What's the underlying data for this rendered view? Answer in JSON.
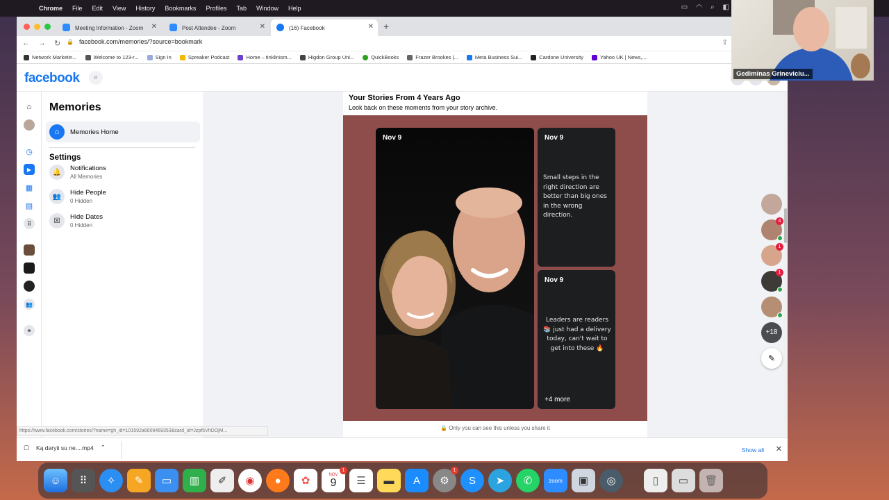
{
  "menubar": {
    "app": "Chrome",
    "items": [
      "File",
      "Edit",
      "View",
      "History",
      "Bookmarks",
      "Profiles",
      "Tab",
      "Window",
      "Help"
    ]
  },
  "tabs": [
    {
      "title": "Meeting Information - Zoom"
    },
    {
      "title": "Post Attendee - Zoom"
    },
    {
      "title": "(16) Facebook"
    }
  ],
  "address": {
    "url": "facebook.com/memories/?source=bookmark"
  },
  "bookmarks": [
    "Network Marketin...",
    "Welcome to 123-r...",
    "Sign In",
    "Spreaker Podcast",
    "Home – tinklinism...",
    "Higdon Group Uni...",
    "QuickBooks",
    "Frazer Brookes |...",
    "Meta Business Sui...",
    "Cardone University",
    "Yahoo UK | News,..."
  ],
  "fb": {
    "logo": "facebook"
  },
  "sidebar": {
    "title": "Memories",
    "home_label": "Memories Home",
    "settings_heading": "Settings",
    "items": [
      {
        "label": "Notifications",
        "sub": "All Memories"
      },
      {
        "label": "Hide People",
        "sub": "0 Hidden"
      },
      {
        "label": "Hide Dates",
        "sub": "0 Hidden"
      }
    ]
  },
  "card": {
    "title": "Your Stories From 4 Years Ago",
    "subtitle": "Look back on these moments from your story archive.",
    "stories": [
      {
        "date": "Nov 9"
      },
      {
        "date": "Nov 9",
        "text": "Small steps in the right direction are better than big ones in the wrong direction."
      },
      {
        "date": "Nov 9",
        "text": "Leaders are readers 📚 just had a delivery today, can't wait to get into these 🔥",
        "more": "+4 more"
      }
    ],
    "privacy": "Only you can see this unless you share it"
  },
  "contacts": {
    "more": "+18",
    "badges": [
      "4",
      "1",
      "1"
    ]
  },
  "statusbar": {
    "url": "https://www.facebook.com/stories/?name=gh_id=101592a6609469353&card_id=Jzpf5VhDOjM..."
  },
  "downloads": {
    "file": "Ką daryti su ne....mp4",
    "show_all": "Show all"
  },
  "zoom": {
    "name": "Gediminas Grineviciu..."
  },
  "dock": {
    "calendar_month": "NOV",
    "calendar_day": "9",
    "zoom_label": "zoom",
    "cal_badge": "1",
    "settings_badge": "1"
  }
}
